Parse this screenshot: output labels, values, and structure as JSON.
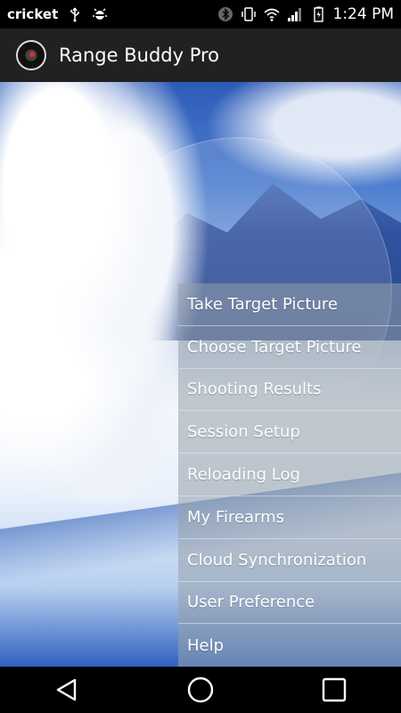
{
  "status_bar": {
    "carrier": "cricket",
    "time": "1:24 PM",
    "icons": [
      "usb-icon",
      "android-debug-icon",
      "bluetooth-icon",
      "vibrate-icon",
      "wifi-icon",
      "signal-icon",
      "battery-icon"
    ]
  },
  "app_bar": {
    "title": "Range Buddy Pro",
    "logo_icon": "target-logo-icon"
  },
  "menu": {
    "items": [
      {
        "label": "Take Target Picture"
      },
      {
        "label": "Choose Target Picture"
      },
      {
        "label": "Shooting Results"
      },
      {
        "label": "Session Setup"
      },
      {
        "label": "Reloading Log"
      },
      {
        "label": "My Firearms"
      },
      {
        "label": "Cloud Synchronization"
      },
      {
        "label": "User Preference"
      },
      {
        "label": "Help"
      }
    ]
  },
  "nav_bar": {
    "buttons": [
      "back-icon",
      "home-icon",
      "recents-icon"
    ]
  },
  "colors": {
    "status_bar_bg": "#000000",
    "app_bar_bg": "#212121",
    "menu_overlay": "#96a0aa"
  }
}
